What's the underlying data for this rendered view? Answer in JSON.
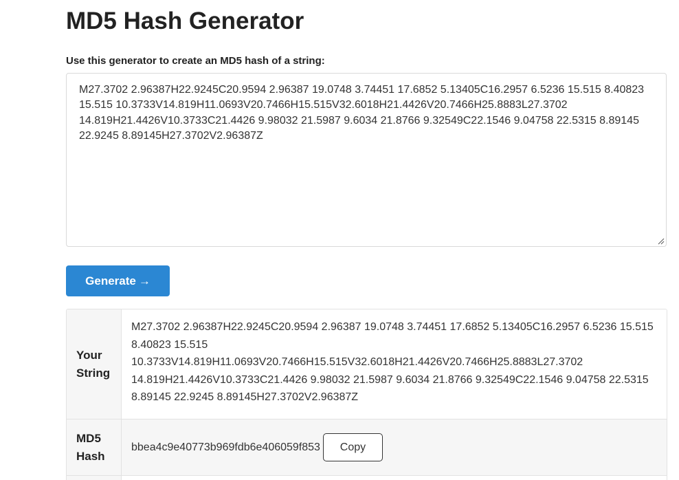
{
  "page": {
    "title": "MD5 Hash Generator",
    "prompt_label": "Use this generator to create an MD5 hash of a string:"
  },
  "input": {
    "value": "M27.3702 2.96387H22.9245C20.9594 2.96387 19.0748 3.74451 17.6852 5.13405C16.2957 6.5236 15.515 8.40823 15.515 10.3733V14.819H11.0693V20.7466H15.515V32.6018H21.4426V20.7466H25.8883L27.3702 14.819H21.4426V10.3733C21.4426 9.98032 21.5987 9.6034 21.8766 9.32549C22.1546 9.04758 22.5315 8.89145 22.9245 8.89145H27.3702V2.96387Z"
  },
  "generate_button": {
    "label": "Generate",
    "arrow": "→"
  },
  "results": {
    "string_label_line1": "Your",
    "string_label_line2": "String",
    "string_value": "M27.3702 2.96387H22.9245C20.9594 2.96387 19.0748 3.74451 17.6852 5.13405C16.2957 6.5236 15.515 8.40823 15.515 10.3733V14.819H11.0693V20.7466H15.515V32.6018H21.4426V20.7466H25.8883L27.3702 14.819H21.4426V10.3733C21.4426 9.98032 21.5987 9.6034 21.8766 9.32549C22.1546 9.04758 22.5315 8.89145 22.9245 8.89145H27.3702V2.96387Z",
    "hash_label_line1": "MD5",
    "hash_label_line2": "Hash",
    "hash_value": "bbea4c9e40773b969fdb6e406059f853",
    "copy_label": "Copy"
  },
  "colors": {
    "accent": "#2b87d3",
    "label_bg": "#f6f6f6",
    "border": "#e2e2e2"
  }
}
